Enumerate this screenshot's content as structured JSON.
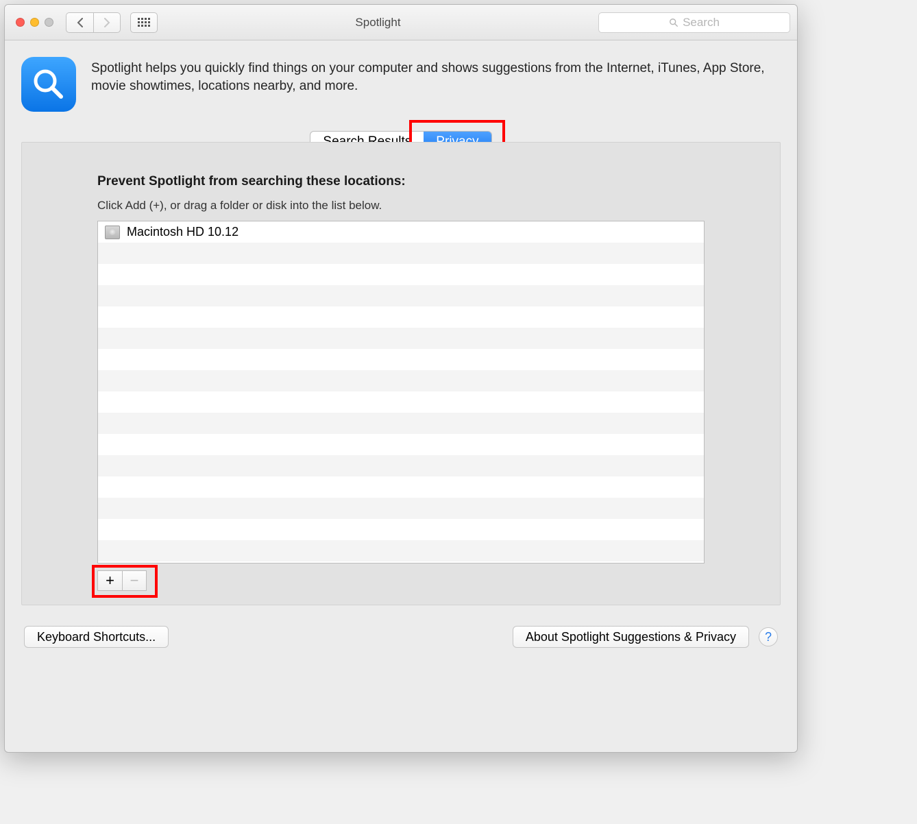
{
  "window": {
    "title": "Spotlight",
    "search_placeholder": "Search"
  },
  "header": {
    "description": "Spotlight helps you quickly find things on your computer and shows suggestions from the Internet, iTunes, App Store, movie showtimes, locations nearby, and more."
  },
  "tabs": {
    "search_results": "Search Results",
    "privacy": "Privacy",
    "active": "privacy"
  },
  "panel": {
    "title": "Prevent Spotlight from searching these locations:",
    "subtitle": "Click Add (+), or drag a folder or disk into the list below.",
    "items": [
      {
        "label": "Macintosh HD 10.12"
      }
    ],
    "add_label": "+",
    "remove_label": "−"
  },
  "footer": {
    "keyboard_shortcuts": "Keyboard Shortcuts...",
    "about": "About Spotlight Suggestions & Privacy",
    "help": "?"
  }
}
